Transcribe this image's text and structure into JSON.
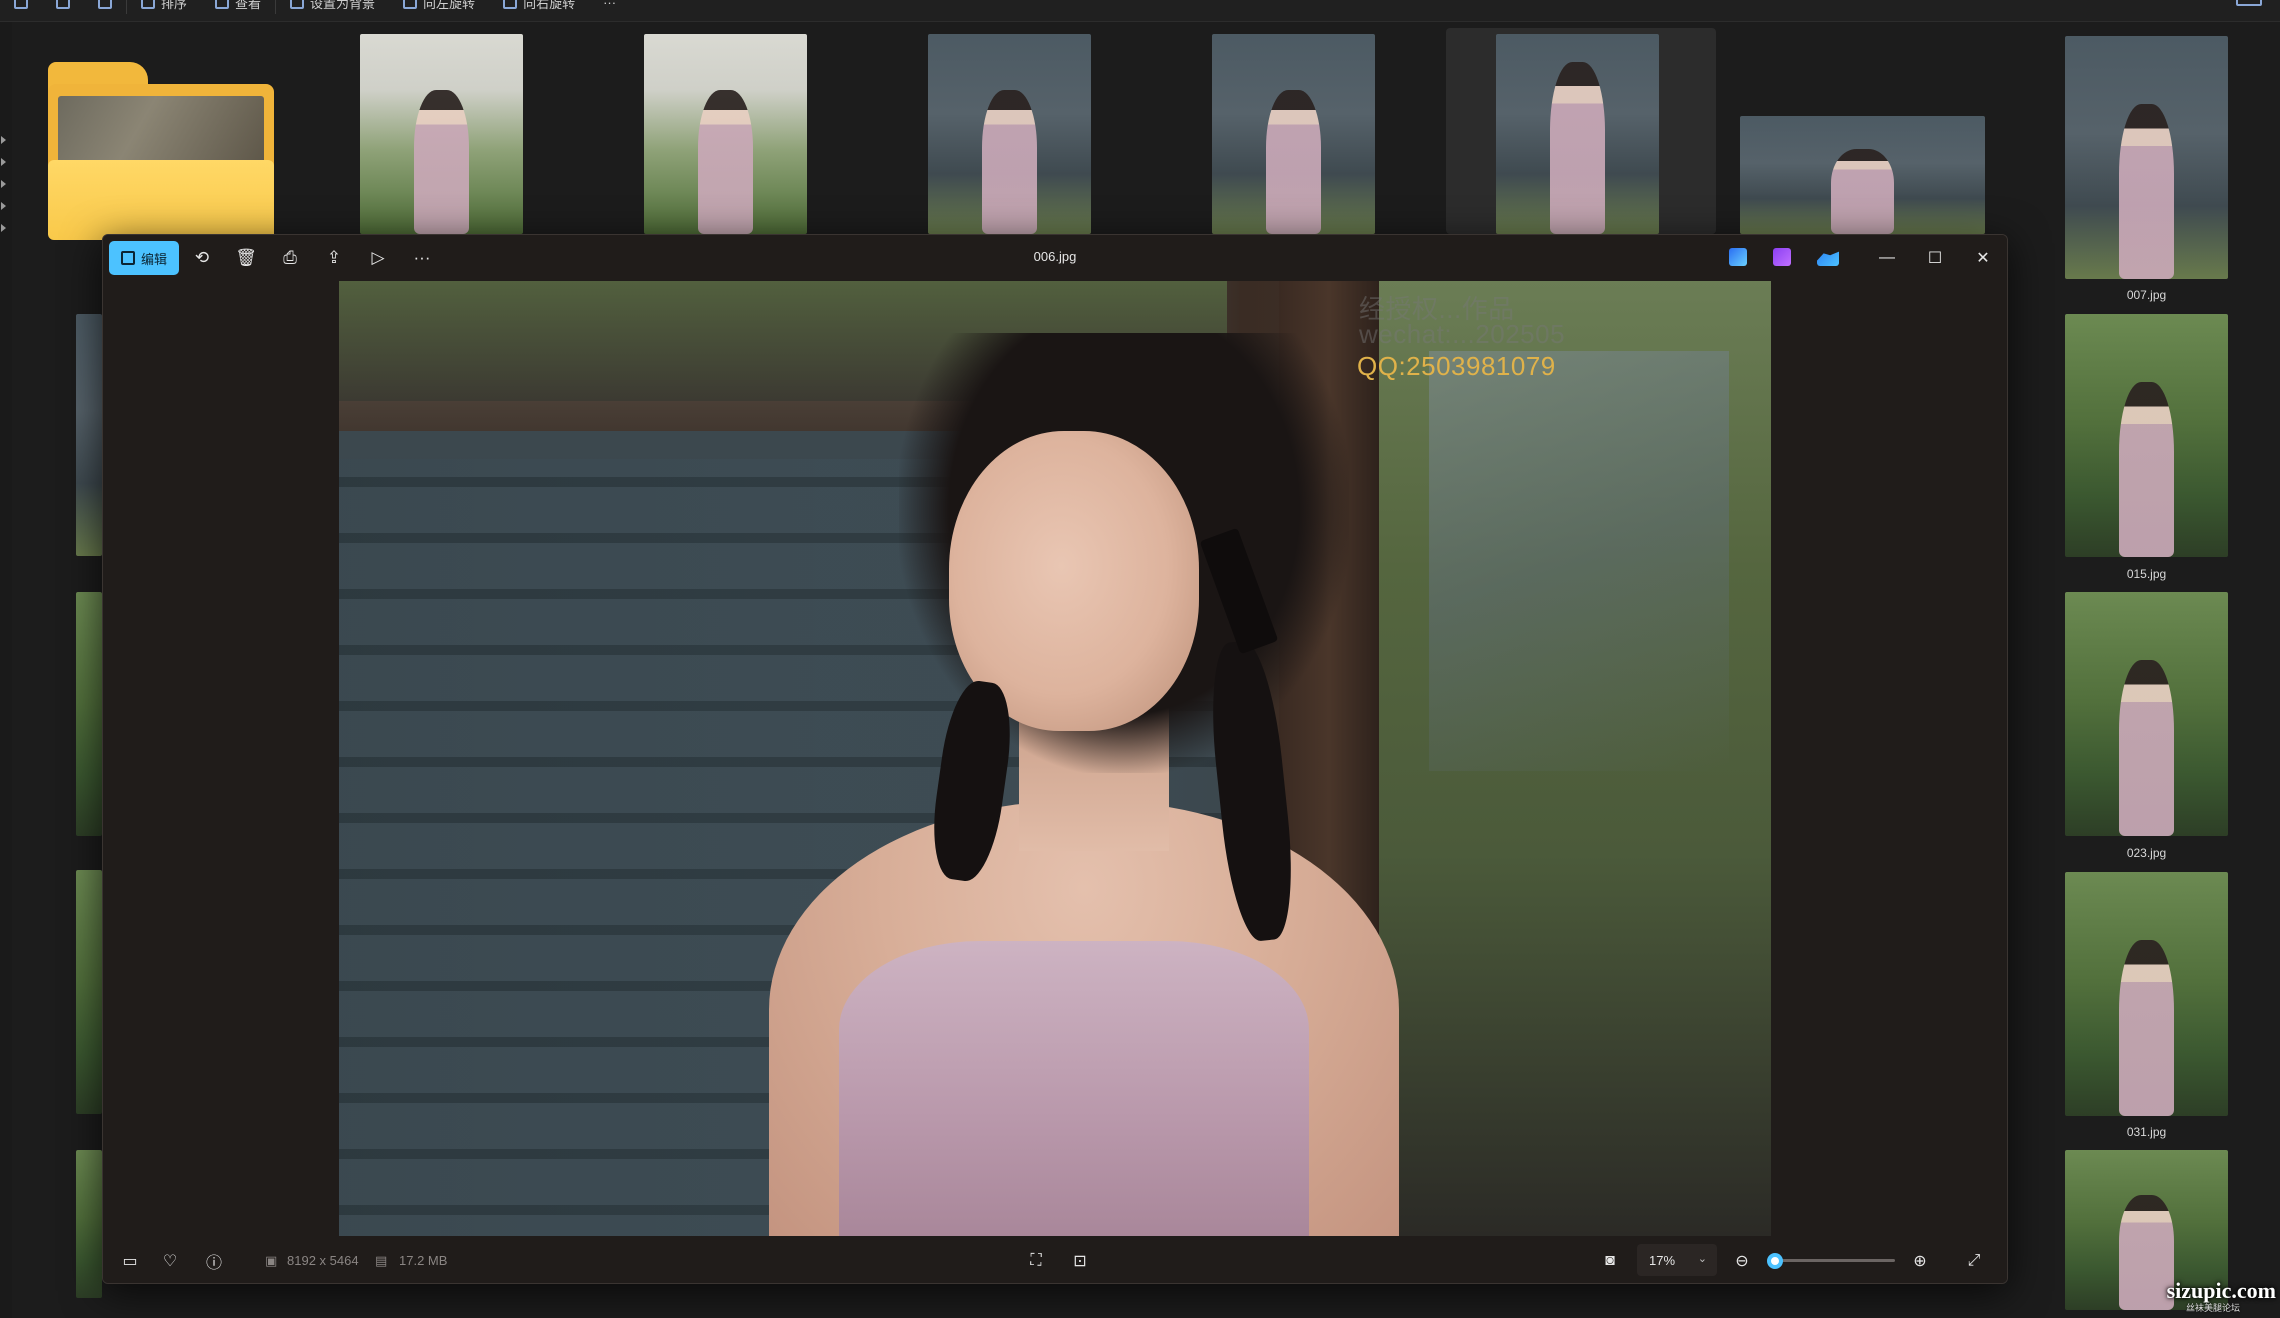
{
  "explorer_toolbar": {
    "items": [
      "排序",
      "查看",
      "设置为背景",
      "向左旋转",
      "向右旋转",
      "···"
    ]
  },
  "top_thumbnails": [
    {
      "name": "folder"
    },
    {
      "name": "photo-1"
    },
    {
      "name": "photo-2"
    },
    {
      "name": "photo-3"
    },
    {
      "name": "photo-4"
    },
    {
      "name": "photo-5"
    },
    {
      "name": "photo-6"
    }
  ],
  "right_column": [
    {
      "filename": "007.jpg"
    },
    {
      "filename": "015.jpg"
    },
    {
      "filename": "023.jpg"
    },
    {
      "filename": "031.jpg"
    },
    {
      "filename": ""
    }
  ],
  "viewer": {
    "edit_label": "编辑",
    "title": "006.jpg",
    "toolbar_icons": [
      "rotate-icon",
      "delete-icon",
      "print-icon",
      "share-icon",
      "slideshow-icon",
      "more-icon"
    ],
    "window_controls": [
      "minimize-icon",
      "maximize-icon",
      "close-icon"
    ],
    "photo_watermark": {
      "line1": "经授权...作品",
      "line2": "wechat:...202505",
      "line3": "QQ:2503981079"
    },
    "bottom": {
      "dimensions": "8192 x 5464",
      "file_size": "17.2 MB",
      "zoom": "17%",
      "zoom_level": 0.0
    }
  },
  "site_watermark": {
    "main": "sizupic.com",
    "sub": "丝袜美腿论坛"
  },
  "colors": {
    "accent": "#4cc2ff",
    "folder": "#f9c94a",
    "watermark_gold": "#e0b24a"
  }
}
